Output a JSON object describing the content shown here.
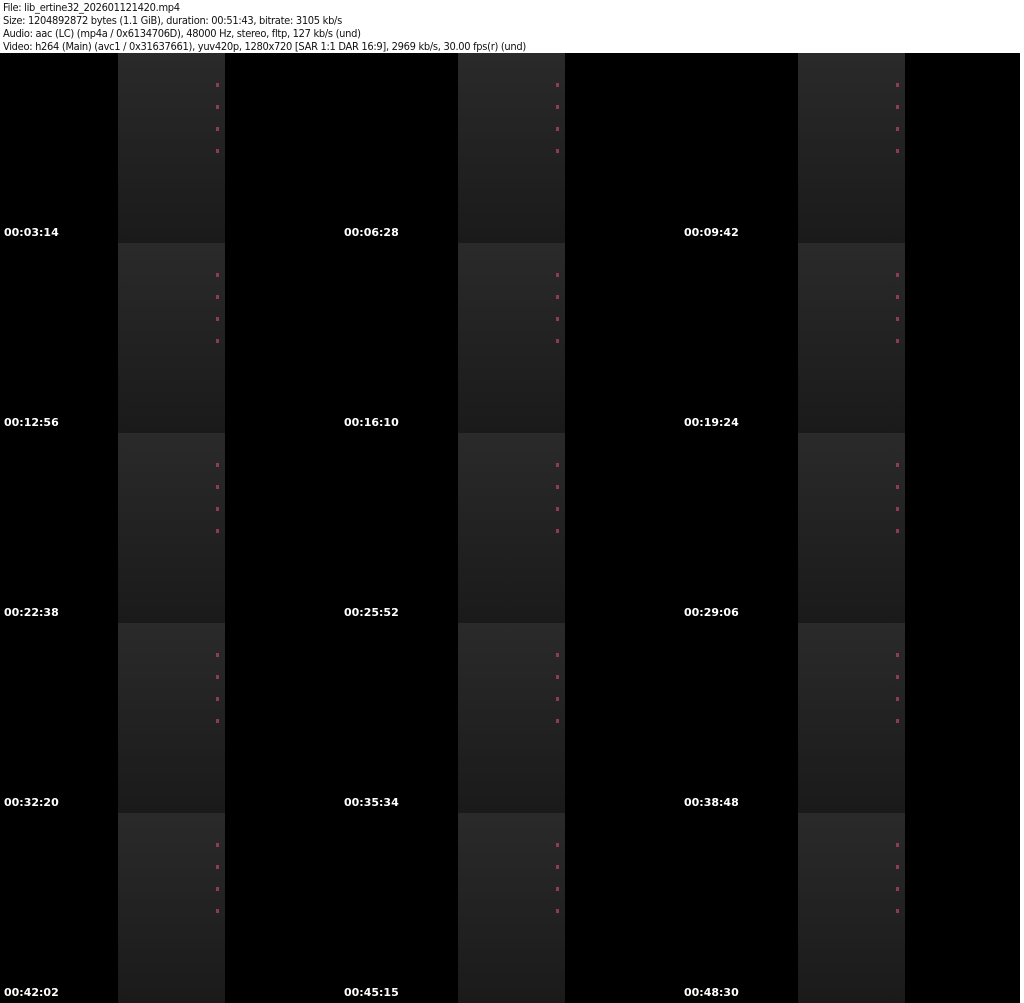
{
  "header": {
    "file": "File: lib_ertine32_202601121420.mp4",
    "size": "Size: 1204892872 bytes (1.1 GiB), duration: 00:51:43, bitrate: 3105 kb/s",
    "audio": "Audio: aac (LC) (mp4a / 0x6134706D), 48000 Hz, stereo, fltp, 127 kb/s (und)",
    "video": "Video: h264 (Main) (avc1 / 0x31637661), yuv420p, 1280x720 [SAR 1:1 DAR 16:9], 2969 kb/s, 30.00 fps(r) (und)"
  },
  "thumbnails": [
    {
      "timestamp": "00:03:14"
    },
    {
      "timestamp": "00:06:28"
    },
    {
      "timestamp": "00:09:42"
    },
    {
      "timestamp": "00:12:56"
    },
    {
      "timestamp": "00:16:10"
    },
    {
      "timestamp": "00:19:24"
    },
    {
      "timestamp": "00:22:38"
    },
    {
      "timestamp": "00:25:52"
    },
    {
      "timestamp": "00:29:06"
    },
    {
      "timestamp": "00:32:20"
    },
    {
      "timestamp": "00:35:34"
    },
    {
      "timestamp": "00:38:48"
    },
    {
      "timestamp": "00:42:02"
    },
    {
      "timestamp": "00:45:15"
    },
    {
      "timestamp": "00:48:30"
    }
  ]
}
